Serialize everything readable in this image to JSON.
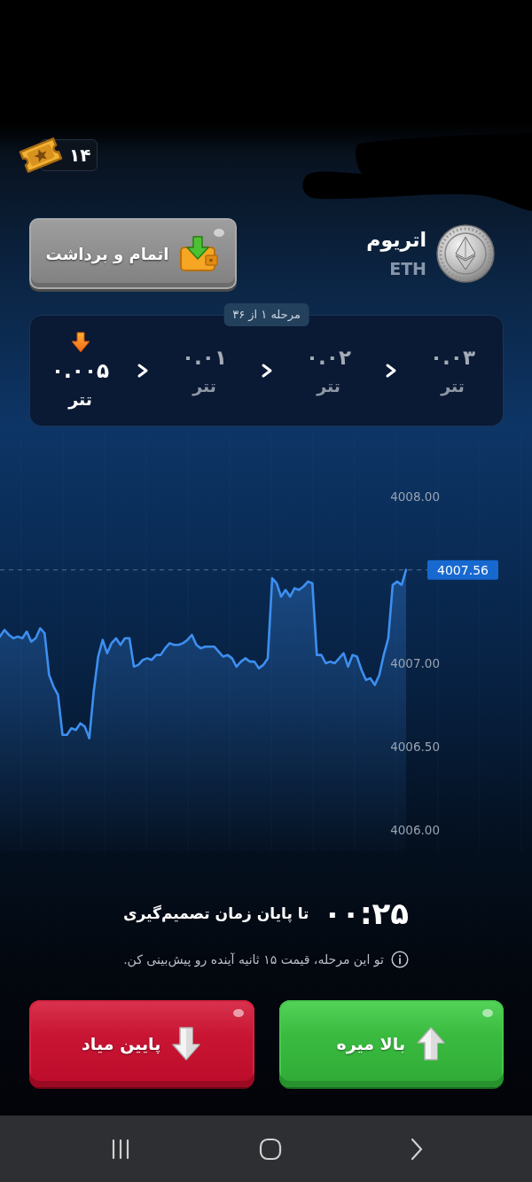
{
  "redactions": [
    {
      "kind": "scribble"
    }
  ],
  "ticket_badge": {
    "count": "۱۴"
  },
  "asset": {
    "name": "اتریوم",
    "symbol": "ETH"
  },
  "withdraw_button": {
    "label": "اتمام و برداشت"
  },
  "stages": {
    "label": "مرحله ۱ از ۳۶",
    "steps": [
      {
        "amount": "۰.۰۳",
        "unit": "تتر",
        "selected": false
      },
      {
        "amount": "۰.۰۲",
        "unit": "تتر",
        "selected": false
      },
      {
        "amount": "۰.۰۱",
        "unit": "تتر",
        "selected": false
      },
      {
        "amount": "۰.۰۰۵",
        "unit": "تتر",
        "selected": true
      }
    ]
  },
  "chart": {
    "chart_data": {
      "type": "area",
      "ylim": [
        4006,
        4008
      ],
      "yticks": [
        {
          "value": 4006,
          "label": "4006.00"
        },
        {
          "value": 4006.5,
          "label": "4006.50"
        },
        {
          "value": 4007,
          "label": "4007.00"
        },
        {
          "value": 4008,
          "label": "4008.00"
        }
      ],
      "series": [
        {
          "color": "#3d8ff0",
          "values": [
            4007.16,
            4007.2,
            4007.17,
            4007.15,
            4007.16,
            4007.15,
            4007.19,
            4007.13,
            4007.15,
            4007.21,
            4007.18,
            4006.93,
            4006.86,
            4006.81,
            4006.57,
            4006.57,
            4006.61,
            4006.6,
            4006.64,
            4006.62,
            4006.55,
            4006.83,
            4007.04,
            4007.14,
            4007.06,
            4007.12,
            4007.15,
            4007.11,
            4007.15,
            4007.15,
            4006.98,
            4006.99,
            4007.02,
            4007.03,
            4007.02,
            4007.05,
            4007.05,
            4007.09,
            4007.12,
            4007.11,
            4007.11,
            4007.12,
            4007.14,
            4007.17,
            4007.11,
            4007.09,
            4007.1,
            4007.1,
            4007.1,
            4007.07,
            4007.04,
            4007.05,
            4007.03,
            4006.98,
            4007.01,
            4007.03,
            4007.01,
            4007.01,
            4006.97,
            4006.99,
            4007.03,
            4007.51,
            4007.48,
            4007.4,
            4007.44,
            4007.4,
            4007.45,
            4007.44,
            4007.46,
            4007.49,
            4007.48,
            4007.05,
            4007.05,
            4007.0,
            4007.01,
            4007.0,
            4007.03,
            4007.06,
            4006.98,
            4007.05,
            4007.04,
            4006.96,
            4006.9,
            4006.91,
            4006.87,
            4006.93,
            4007.05,
            4007.15,
            4007.47,
            4007.49,
            4007.47,
            4007.56
          ]
        }
      ],
      "ref_lines": [
        {
          "axis": "y",
          "value": 4007.56,
          "label": "4007.56"
        }
      ]
    }
  },
  "timer": {
    "time": "۰۰:۲۵",
    "label": "تا پایان زمان تصمیم‌گیری"
  },
  "hint": {
    "text": "تو این مرحله، قیمت ۱۵ ثانیه آینده رو پیش‌بینی کن."
  },
  "actions": [
    {
      "kind": "up",
      "label": "بالا میره"
    },
    {
      "kind": "down",
      "label": "پایین میاد"
    }
  ]
}
